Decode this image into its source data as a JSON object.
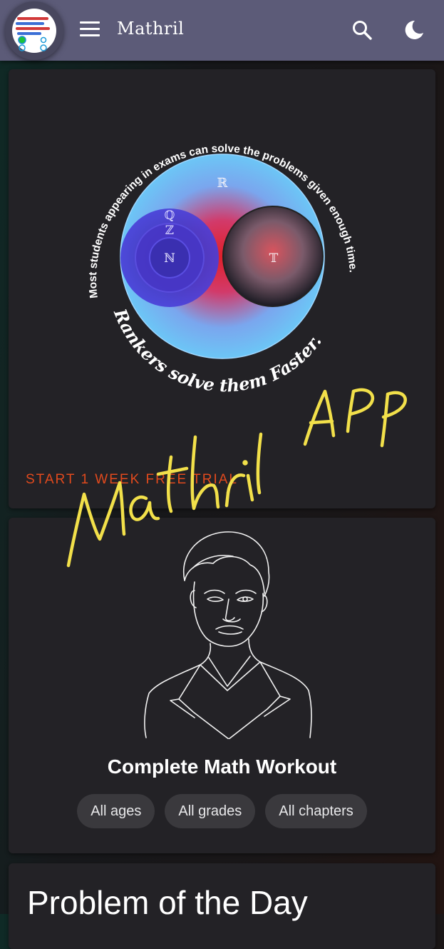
{
  "appbar": {
    "title": "Mathril",
    "menu_icon": "hamburger-menu-icon",
    "search_icon": "search-icon",
    "theme_icon": "moon-icon"
  },
  "hero": {
    "arc_text_top": "Most students appearing in exams can solve the problems given enough time.",
    "arc_text_bottom": "Rankers solve them Faster.",
    "venn_labels": {
      "r": "ℝ",
      "q": "ℚ",
      "z": "ℤ",
      "n": "ℕ",
      "t": "𝕋"
    },
    "cta_label": "START 1 WEEK FREE TRIAL"
  },
  "workout": {
    "title": "Complete Math Workout",
    "chips": [
      "All ages",
      "All grades",
      "All chapters"
    ]
  },
  "potd": {
    "title": "Problem of the Day"
  },
  "handwritten_overlay": "Mathril App",
  "colors": {
    "appbar": "#5c5b78",
    "card": "#232226",
    "cta": "#e24a1d",
    "overlay_yellow": "#f2e04a"
  }
}
